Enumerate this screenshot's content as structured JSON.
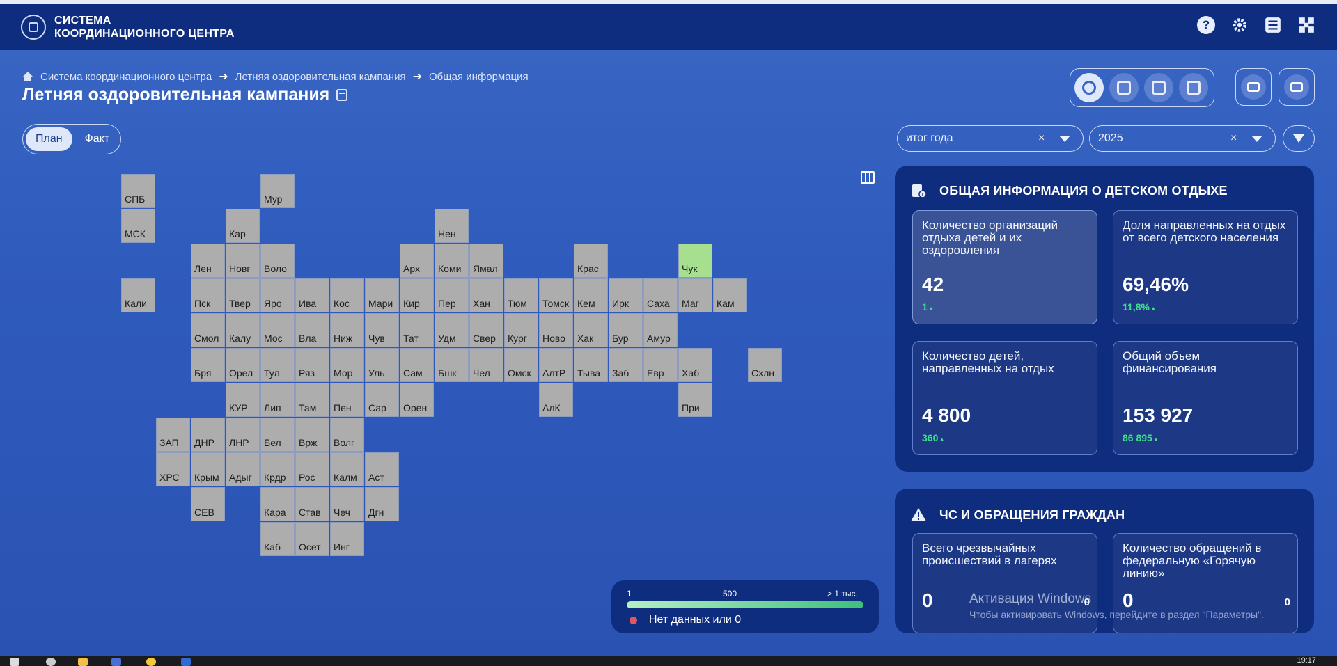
{
  "app": {
    "brand_line1": "СИСТЕМА",
    "brand_line2": "КООРДИНАЦИОННОГО ЦЕНТРА"
  },
  "header_icons": [
    "help-icon",
    "gear-icon",
    "list-icon",
    "grid-icon"
  ],
  "breadcrumb": [
    "Система координационного центра",
    "Летняя оздоровительная кампания",
    "Общая информация"
  ],
  "page_title": "Летняя оздоровительная кампания",
  "plan_fact": {
    "plan": "План",
    "fact": "Факт",
    "selected": "План"
  },
  "view_buttons": [
    "award-icon",
    "bar-chart-icon",
    "trend-icon",
    "clock-chart-icon"
  ],
  "tools": [
    "camera-icon",
    "download-icon"
  ],
  "filters": {
    "period": "итог года",
    "year": "2025",
    "clear": "×"
  },
  "regions": [
    {
      "code": "СПБ",
      "col": 0,
      "row": 0
    },
    {
      "code": "Мур",
      "col": 4,
      "row": 0
    },
    {
      "code": "МСК",
      "col": 0,
      "row": 1
    },
    {
      "code": "Кар",
      "col": 3,
      "row": 1
    },
    {
      "code": "Нен",
      "col": 9,
      "row": 1
    },
    {
      "code": "Лен",
      "col": 2,
      "row": 2
    },
    {
      "code": "Новг",
      "col": 3,
      "row": 2
    },
    {
      "code": "Воло",
      "col": 4,
      "row": 2
    },
    {
      "code": "Арх",
      "col": 8,
      "row": 2
    },
    {
      "code": "Коми",
      "col": 9,
      "row": 2
    },
    {
      "code": "Ямал",
      "col": 10,
      "row": 2
    },
    {
      "code": "Крас",
      "col": 13,
      "row": 2
    },
    {
      "code": "Чук",
      "col": 16,
      "row": 2,
      "active": true
    },
    {
      "code": "Кали",
      "col": 0,
      "row": 3
    },
    {
      "code": "Пск",
      "col": 2,
      "row": 3
    },
    {
      "code": "Твер",
      "col": 3,
      "row": 3
    },
    {
      "code": "Яро",
      "col": 4,
      "row": 3
    },
    {
      "code": "Ива",
      "col": 5,
      "row": 3
    },
    {
      "code": "Кос",
      "col": 6,
      "row": 3
    },
    {
      "code": "Мари",
      "col": 7,
      "row": 3
    },
    {
      "code": "Кир",
      "col": 8,
      "row": 3
    },
    {
      "code": "Пер",
      "col": 9,
      "row": 3
    },
    {
      "code": "Хан",
      "col": 10,
      "row": 3
    },
    {
      "code": "Тюм",
      "col": 11,
      "row": 3
    },
    {
      "code": "Томск",
      "col": 12,
      "row": 3
    },
    {
      "code": "Кем",
      "col": 13,
      "row": 3
    },
    {
      "code": "Ирк",
      "col": 14,
      "row": 3
    },
    {
      "code": "Саха",
      "col": 15,
      "row": 3
    },
    {
      "code": "Маг",
      "col": 16,
      "row": 3
    },
    {
      "code": "Кам",
      "col": 17,
      "row": 3
    },
    {
      "code": "Смол",
      "col": 2,
      "row": 4
    },
    {
      "code": "Калу",
      "col": 3,
      "row": 4
    },
    {
      "code": "Мос",
      "col": 4,
      "row": 4
    },
    {
      "code": "Вла",
      "col": 5,
      "row": 4
    },
    {
      "code": "Ниж",
      "col": 6,
      "row": 4
    },
    {
      "code": "Чув",
      "col": 7,
      "row": 4
    },
    {
      "code": "Тат",
      "col": 8,
      "row": 4
    },
    {
      "code": "Удм",
      "col": 9,
      "row": 4
    },
    {
      "code": "Свер",
      "col": 10,
      "row": 4
    },
    {
      "code": "Кург",
      "col": 11,
      "row": 4
    },
    {
      "code": "Ново",
      "col": 12,
      "row": 4
    },
    {
      "code": "Хак",
      "col": 13,
      "row": 4
    },
    {
      "code": "Бур",
      "col": 14,
      "row": 4
    },
    {
      "code": "Амур",
      "col": 15,
      "row": 4
    },
    {
      "code": "Бря",
      "col": 2,
      "row": 5
    },
    {
      "code": "Орел",
      "col": 3,
      "row": 5
    },
    {
      "code": "Тул",
      "col": 4,
      "row": 5
    },
    {
      "code": "Ряз",
      "col": 5,
      "row": 5
    },
    {
      "code": "Мор",
      "col": 6,
      "row": 5
    },
    {
      "code": "Уль",
      "col": 7,
      "row": 5
    },
    {
      "code": "Сам",
      "col": 8,
      "row": 5
    },
    {
      "code": "Бшк",
      "col": 9,
      "row": 5
    },
    {
      "code": "Чел",
      "col": 10,
      "row": 5
    },
    {
      "code": "Омск",
      "col": 11,
      "row": 5
    },
    {
      "code": "АлтР",
      "col": 12,
      "row": 5
    },
    {
      "code": "Тыва",
      "col": 13,
      "row": 5
    },
    {
      "code": "Заб",
      "col": 14,
      "row": 5
    },
    {
      "code": "Евр",
      "col": 15,
      "row": 5
    },
    {
      "code": "Хаб",
      "col": 16,
      "row": 5
    },
    {
      "code": "Схлн",
      "col": 18,
      "row": 5
    },
    {
      "code": "КУР",
      "col": 3,
      "row": 6
    },
    {
      "code": "Лип",
      "col": 4,
      "row": 6
    },
    {
      "code": "Там",
      "col": 5,
      "row": 6
    },
    {
      "code": "Пен",
      "col": 6,
      "row": 6
    },
    {
      "code": "Сар",
      "col": 7,
      "row": 6
    },
    {
      "code": "Орен",
      "col": 8,
      "row": 6
    },
    {
      "code": "АлК",
      "col": 12,
      "row": 6
    },
    {
      "code": "При",
      "col": 16,
      "row": 6
    },
    {
      "code": "ЗАП",
      "col": 1,
      "row": 7
    },
    {
      "code": "ДНР",
      "col": 2,
      "row": 7
    },
    {
      "code": "ЛНР",
      "col": 3,
      "row": 7
    },
    {
      "code": "Бел",
      "col": 4,
      "row": 7
    },
    {
      "code": "Врж",
      "col": 5,
      "row": 7
    },
    {
      "code": "Волг",
      "col": 6,
      "row": 7
    },
    {
      "code": "ХРС",
      "col": 1,
      "row": 8
    },
    {
      "code": "Крым",
      "col": 2,
      "row": 8
    },
    {
      "code": "Адыг",
      "col": 3,
      "row": 8
    },
    {
      "code": "Крдр",
      "col": 4,
      "row": 8
    },
    {
      "code": "Рос",
      "col": 5,
      "row": 8
    },
    {
      "code": "Калм",
      "col": 6,
      "row": 8
    },
    {
      "code": "Аст",
      "col": 7,
      "row": 8
    },
    {
      "code": "СЕВ",
      "col": 2,
      "row": 9
    },
    {
      "code": "Кара",
      "col": 4,
      "row": 9
    },
    {
      "code": "Став",
      "col": 5,
      "row": 9
    },
    {
      "code": "Чеч",
      "col": 6,
      "row": 9
    },
    {
      "code": "Дгн",
      "col": 7,
      "row": 9
    },
    {
      "code": "Каб",
      "col": 4,
      "row": 10
    },
    {
      "code": "Осет",
      "col": 5,
      "row": 10
    },
    {
      "code": "Инг",
      "col": 6,
      "row": 10
    }
  ],
  "legend": {
    "min": "1",
    "mid": "500",
    "max": "> 1 тыс.",
    "no_data": "Нет данных или 0",
    "color_low": "#b6f0c2",
    "color_high": "#3fbf7a",
    "no_data_color": "#e0575e"
  },
  "panel1": {
    "title": "ОБЩАЯ ИНФОРМАЦИЯ О ДЕТСКОМ ОТДЫХЕ",
    "cards": [
      {
        "title": "Количество организаций отдыха детей и их оздоровления",
        "value": "42",
        "delta": "1"
      },
      {
        "title": "Доля направленных на отдых от всего детского населения",
        "value": "69,46%",
        "delta": "11,8%"
      },
      {
        "title": "Количество детей, направленных на отдых",
        "value": "4 800",
        "delta": "360"
      },
      {
        "title": "Общий объем финансирования",
        "value": "153 927",
        "delta": "86 895"
      }
    ]
  },
  "panel2": {
    "title": "ЧС И ОБРАЩЕНИЯ ГРАЖДАН",
    "cards": [
      {
        "title": "Всего чрезвычайных происшествий в лагерях",
        "value": "0",
        "side": "0"
      },
      {
        "title": "Количество обращений в федеральную «Горячую линию»",
        "value": "0",
        "side": "0"
      }
    ]
  },
  "watermark": {
    "line1": "Активация Windows",
    "line2": "Чтобы активировать Windows, перейдите в раздел \"Параметры\"."
  },
  "taskbar": {
    "clock": "19:17"
  },
  "colors": {
    "header": "#0f2d7f",
    "background": "#3a67c4",
    "tile": "#adadad",
    "tile_active": "#a6e08f",
    "accent_green": "#3fe08b"
  }
}
